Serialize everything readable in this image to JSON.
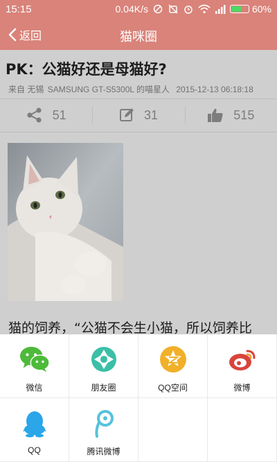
{
  "status_bar": {
    "time": "15:15",
    "network_speed": "0.04K/s",
    "battery_percent": "60%",
    "battery_level": 0.6
  },
  "header": {
    "back_label": "返回",
    "title": "猫咪圈"
  },
  "article": {
    "title": "PK：公猫好还是母猫好?",
    "meta_from": "来自 无锡",
    "meta_device": "SAMSUNG GT-S5300L 的喵星人",
    "meta_time": "2015-12-13 06:18:18",
    "share_count": "51",
    "comment_count": "31",
    "like_count": "515",
    "text_preview": "猫的饲养，“公猫不会生小猫，所以饲养比"
  },
  "share_options": [
    {
      "label": "微信",
      "icon": "wechat-icon"
    },
    {
      "label": "朋友圈",
      "icon": "moments-icon"
    },
    {
      "label": "QQ空间",
      "icon": "qzone-icon"
    },
    {
      "label": "微博",
      "icon": "weibo-icon"
    },
    {
      "label": "QQ",
      "icon": "qq-icon"
    },
    {
      "label": "腾讯微博",
      "icon": "tencent-weibo-icon"
    }
  ],
  "colors": {
    "header_bg": "#d9837a",
    "wechat": "#4dba3a",
    "moments": "#3bbfa6",
    "qzone": "#f1b02a",
    "weibo": "#d9443c",
    "qq": "#2aa6e9",
    "tencent_weibo": "#56c2dc"
  }
}
